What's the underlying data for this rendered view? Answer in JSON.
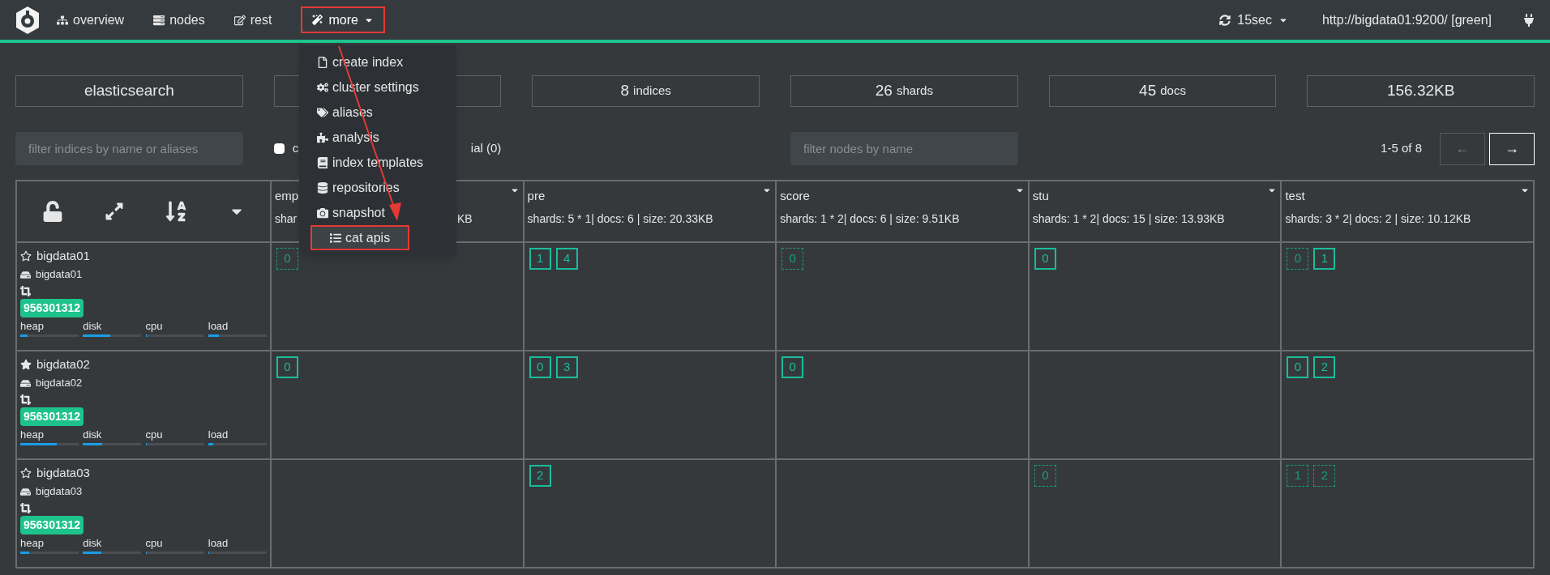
{
  "nav": {
    "items": [
      {
        "label": "overview"
      },
      {
        "label": "nodes"
      },
      {
        "label": "rest"
      }
    ],
    "more": {
      "label": "more",
      "expanded": true
    },
    "refresh": "15sec",
    "cluster_url": "http://bigdata01:9200/ [green]"
  },
  "menu": [
    {
      "label": "create index",
      "selected": false
    },
    {
      "label": "cluster settings",
      "selected": false
    },
    {
      "label": "aliases",
      "selected": false
    },
    {
      "label": "analysis",
      "selected": false
    },
    {
      "label": "index templates",
      "selected": false
    },
    {
      "label": "repositories",
      "selected": false
    },
    {
      "label": "snapshot",
      "selected": false
    },
    {
      "label": "cat apis",
      "selected": true
    }
  ],
  "stats": [
    {
      "kind": "text",
      "value": "elasticsearch"
    },
    {
      "kind": "covered"
    },
    {
      "kind": "count",
      "value": "8",
      "unit": "indices"
    },
    {
      "kind": "count",
      "value": "26",
      "unit": "shards"
    },
    {
      "kind": "count",
      "value": "45",
      "unit": "docs"
    },
    {
      "kind": "text",
      "value": "156.32KB"
    }
  ],
  "filters": {
    "indices_placeholder": "filter indices by name or aliases",
    "special_checked": false,
    "special_label_start": "c",
    "special_label_end": "ial (0)",
    "nodes_placeholder": "filter nodes by name"
  },
  "pagination": {
    "range": "1-5 of 8",
    "prev": {
      "label": "←",
      "disabled": true
    },
    "next": {
      "label": "→",
      "disabled": false
    }
  },
  "indices": [
    {
      "name": "emp",
      "info": "shar",
      "info_end": "KB"
    },
    {
      "name": "pre",
      "info": "shards: 5 * 1| docs: 6 | size: 20.33KB"
    },
    {
      "name": "score",
      "info": "shards: 1 * 2| docs: 6 | size: 9.51KB"
    },
    {
      "name": "stu",
      "info": "shards: 1 * 2| docs: 15 | size: 13.93KB"
    },
    {
      "name": "test",
      "info": "shards: 3 * 2| docs: 2 | size: 10.12KB"
    }
  ],
  "nodes": [
    {
      "name": "bigdata01",
      "host": "bigdata01",
      "master": false,
      "badge": "956301312",
      "meters": [
        {
          "label": "heap",
          "level": 0.13
        },
        {
          "label": "disk",
          "level": 0.47
        },
        {
          "label": "cpu",
          "level": 0.02
        },
        {
          "label": "load",
          "level": 0.18
        }
      ],
      "cells": [
        {
          "kind": "shards",
          "shards": [
            {
              "label": "0",
              "kind": "replica"
            }
          ]
        },
        {
          "kind": "shards",
          "shards": [
            {
              "label": "1",
              "kind": "primary"
            },
            {
              "label": "4",
              "kind": "primary"
            }
          ]
        },
        {
          "kind": "shards",
          "shards": [
            {
              "label": "0",
              "kind": "replica"
            }
          ]
        },
        {
          "kind": "shards",
          "shards": [
            {
              "label": "0",
              "kind": "primary"
            }
          ]
        },
        {
          "kind": "shards",
          "shards": [
            {
              "label": "0",
              "kind": "replica"
            },
            {
              "label": "1",
              "kind": "primary"
            }
          ]
        }
      ]
    },
    {
      "name": "bigdata02",
      "host": "bigdata02",
      "master": true,
      "badge": "956301312",
      "meters": [
        {
          "label": "heap",
          "level": 0.63
        },
        {
          "label": "disk",
          "level": 0.33
        },
        {
          "label": "cpu",
          "level": 0.02
        },
        {
          "label": "load",
          "level": 0.08
        }
      ],
      "cells": [
        {
          "kind": "shards",
          "shards": [
            {
              "label": "0",
              "kind": "primary"
            }
          ]
        },
        {
          "kind": "shards",
          "shards": [
            {
              "label": "0",
              "kind": "primary"
            },
            {
              "label": "3",
              "kind": "primary"
            }
          ]
        },
        {
          "kind": "shards",
          "shards": [
            {
              "label": "0",
              "kind": "primary"
            }
          ]
        },
        {
          "kind": "empty"
        },
        {
          "kind": "shards",
          "shards": [
            {
              "label": "0",
              "kind": "primary"
            },
            {
              "label": "2",
              "kind": "primary"
            }
          ]
        }
      ]
    },
    {
      "name": "bigdata03",
      "host": "bigdata03",
      "master": false,
      "badge": "956301312",
      "meters": [
        {
          "label": "heap",
          "level": 0.15
        },
        {
          "label": "disk",
          "level": 0.32
        },
        {
          "label": "cpu",
          "level": 0.02
        },
        {
          "label": "load",
          "level": 0.02
        }
      ],
      "cells": [
        {
          "kind": "empty"
        },
        {
          "kind": "shards",
          "shards": [
            {
              "label": "2",
              "kind": "primary"
            }
          ]
        },
        {
          "kind": "empty"
        },
        {
          "kind": "shards",
          "shards": [
            {
              "label": "0",
              "kind": "replica"
            }
          ]
        },
        {
          "kind": "shards",
          "shards": [
            {
              "label": "1",
              "kind": "replica"
            },
            {
              "label": "2",
              "kind": "replica"
            }
          ]
        }
      ]
    }
  ]
}
